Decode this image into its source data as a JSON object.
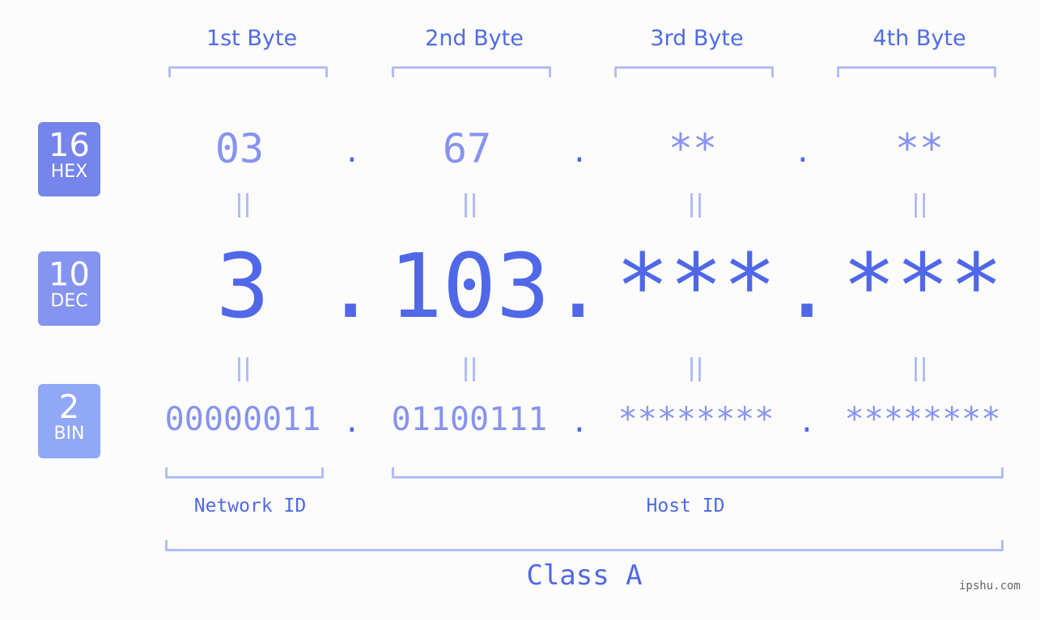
{
  "byte_headers": [
    "1st Byte",
    "2nd Byte",
    "3rd Byte",
    "4th Byte"
  ],
  "bases": [
    {
      "num": "16",
      "label": "HEX",
      "color": "#7585ec"
    },
    {
      "num": "10",
      "label": "DEC",
      "color": "#8593f1"
    },
    {
      "num": "2",
      "label": "BIN",
      "color": "#90a8f7"
    }
  ],
  "hex": [
    "03",
    "67",
    "**",
    "**"
  ],
  "dec": [
    "3",
    "103",
    "***",
    "***"
  ],
  "bin": [
    "00000011",
    "01100111",
    "********",
    "********"
  ],
  "separator": ".",
  "equals": "=",
  "network_id_label": "Network ID",
  "host_id_label": "Host ID",
  "class_label": "Class A",
  "watermark": "ipshu.com"
}
